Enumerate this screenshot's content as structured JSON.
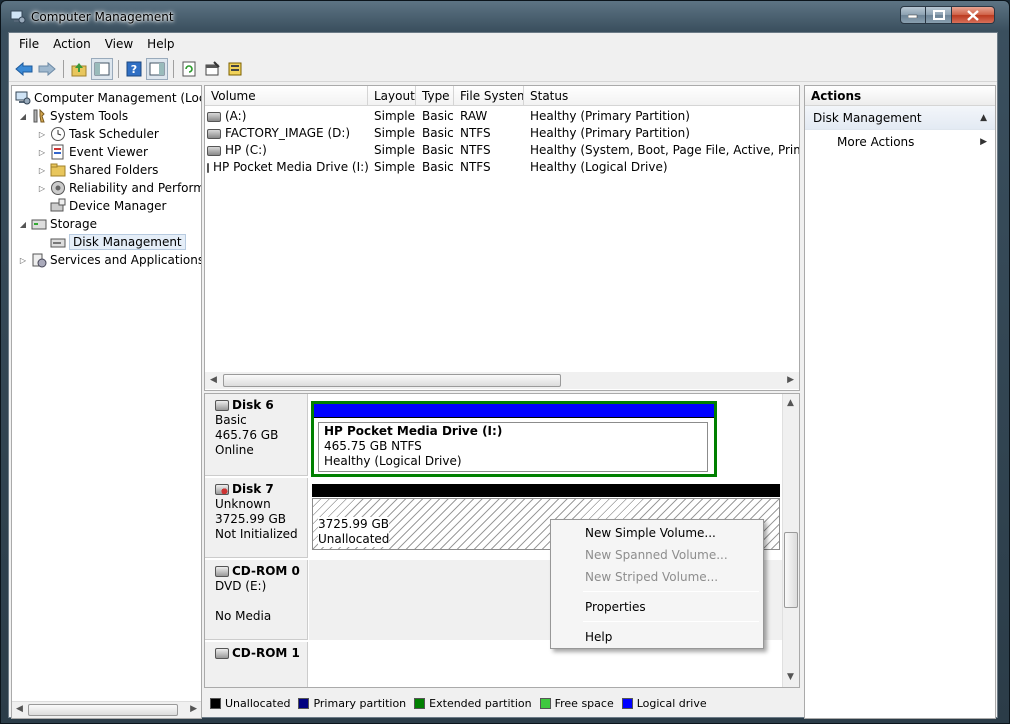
{
  "window": {
    "title": "Computer Management"
  },
  "menu": [
    "File",
    "Action",
    "View",
    "Help"
  ],
  "toolbar": [
    "back-arrow-icon",
    "forward-arrow-icon",
    "up-folder-icon",
    "show-hide-tree-icon",
    "help-icon",
    "show-hide-action-icon",
    "refresh-icon",
    "properties-icon",
    "export-icon"
  ],
  "tree": {
    "root": "Computer Management (Local",
    "system_tools": "System Tools",
    "task_scheduler": "Task Scheduler",
    "event_viewer": "Event Viewer",
    "shared_folders": "Shared Folders",
    "reliability": "Reliability and Performa",
    "device_manager": "Device Manager",
    "storage": "Storage",
    "disk_management": "Disk Management",
    "services": "Services and Applications"
  },
  "volumes": {
    "columns": [
      "Volume",
      "Layout",
      "Type",
      "File System",
      "Status"
    ],
    "rows": [
      [
        "(A:)",
        "Simple",
        "Basic",
        "RAW",
        "Healthy (Primary Partition)"
      ],
      [
        "FACTORY_IMAGE (D:)",
        "Simple",
        "Basic",
        "NTFS",
        "Healthy (Primary Partition)"
      ],
      [
        "HP (C:)",
        "Simple",
        "Basic",
        "NTFS",
        "Healthy (System, Boot, Page File, Active, Primary Pa"
      ],
      [
        "HP Pocket Media Drive (I:)",
        "Simple",
        "Basic",
        "NTFS",
        "Healthy (Logical Drive)"
      ]
    ]
  },
  "disks": {
    "disk6": {
      "name": "Disk 6",
      "type": "Basic",
      "size": "465.76 GB",
      "state": "Online",
      "part_name": "HP Pocket Media Drive  (I:)",
      "part_size": "465.75 GB NTFS",
      "part_status": "Healthy (Logical Drive)"
    },
    "disk7": {
      "name": "Disk 7",
      "type": "Unknown",
      "size": "3725.99 GB",
      "state": "Not Initialized",
      "part_size": "3725.99 GB",
      "part_status": "Unallocated"
    },
    "cdrom0": {
      "name": "CD-ROM 0",
      "type": "DVD (E:)",
      "state": "No Media"
    },
    "cdrom1": {
      "name": "CD-ROM 1"
    }
  },
  "legend": [
    {
      "label": "Unallocated",
      "color": "#000000"
    },
    {
      "label": "Primary partition",
      "color": "#000080"
    },
    {
      "label": "Extended partition",
      "color": "#008000"
    },
    {
      "label": "Free space",
      "color": "#3ec83e"
    },
    {
      "label": "Logical drive",
      "color": "#0000ff"
    }
  ],
  "actions": {
    "title": "Actions",
    "section": "Disk Management",
    "more": "More Actions"
  },
  "context_menu": {
    "new_simple": "New Simple Volume...",
    "new_spanned": "New Spanned Volume...",
    "new_striped": "New Striped Volume...",
    "properties": "Properties",
    "help": "Help"
  }
}
